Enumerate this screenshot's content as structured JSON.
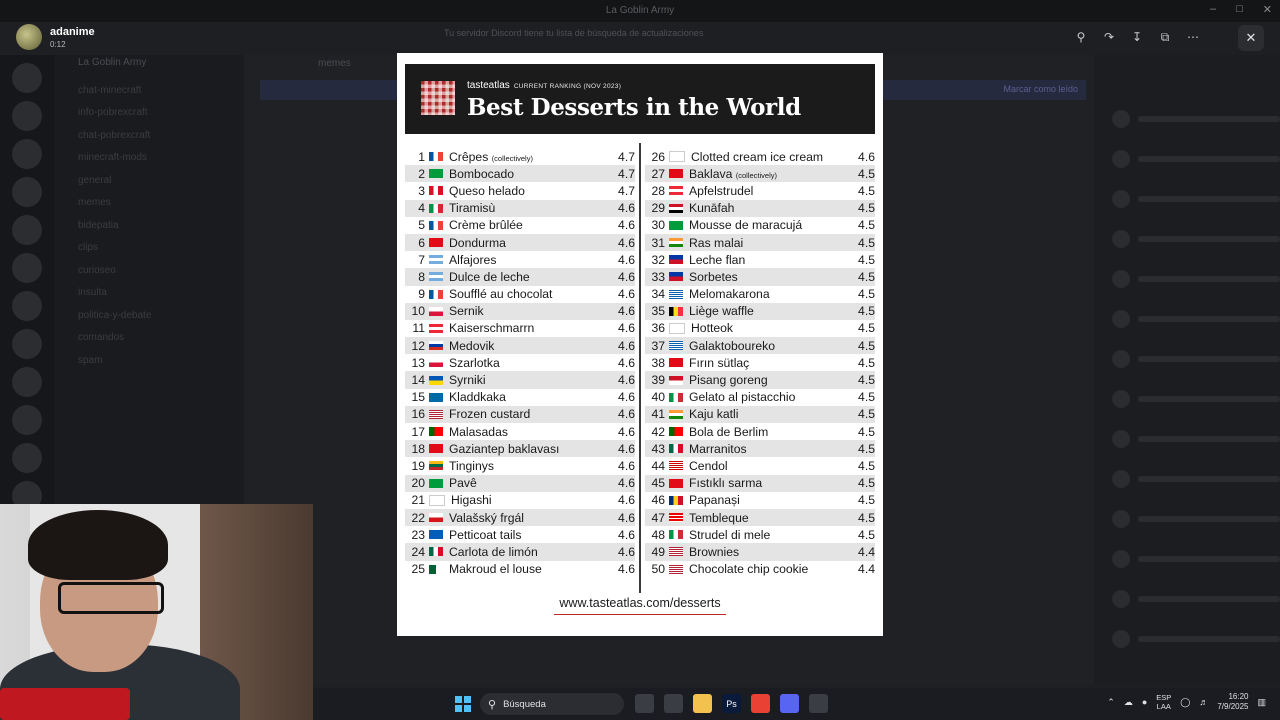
{
  "window": {
    "title": "La Goblin Army"
  },
  "server": {
    "name": "La Goblin Army",
    "channel": "memes"
  },
  "notice": {
    "text": "Tu servidor Discord tiene tu lista de búsqueda de actualizaciones"
  },
  "banner": {
    "button": "Marcar como leído"
  },
  "viewer": {
    "username": "adanime",
    "timestamp": "0:12"
  },
  "background_channels": [
    "chat-minecraft",
    "info-pobrexcraft",
    "chat-pobrexcraft",
    "minecraft-mods",
    "general",
    "memes",
    "bidepatia",
    "clips",
    "curioseo",
    "insulta",
    "politica-y-debate",
    "comandos",
    "spam"
  ],
  "image": {
    "brand": "tasteatlas",
    "ranking_label": "CURRENT RANKING (NOV 2023)",
    "title": "Best Desserts in the World",
    "url": "www.tasteatlas.com/desserts",
    "left": [
      {
        "rank": "1",
        "name": "Crêpes",
        "note": "(collectively)",
        "score": "4.7",
        "flag": "fr"
      },
      {
        "rank": "2",
        "name": "Bombocado",
        "note": "",
        "score": "4.7",
        "flag": "br"
      },
      {
        "rank": "3",
        "name": "Queso helado",
        "note": "",
        "score": "4.7",
        "flag": "pe"
      },
      {
        "rank": "4",
        "name": "Tiramisù",
        "note": "",
        "score": "4.6",
        "flag": "it"
      },
      {
        "rank": "5",
        "name": "Crème brûlée",
        "note": "",
        "score": "4.6",
        "flag": "fr"
      },
      {
        "rank": "6",
        "name": "Dondurma",
        "note": "",
        "score": "4.6",
        "flag": "tr"
      },
      {
        "rank": "7",
        "name": "Alfajores",
        "note": "",
        "score": "4.6",
        "flag": "ar"
      },
      {
        "rank": "8",
        "name": "Dulce de leche",
        "note": "",
        "score": "4.6",
        "flag": "ar"
      },
      {
        "rank": "9",
        "name": "Soufflé au chocolat",
        "note": "",
        "score": "4.6",
        "flag": "fr"
      },
      {
        "rank": "10",
        "name": "Sernik",
        "note": "",
        "score": "4.6",
        "flag": "pl"
      },
      {
        "rank": "11",
        "name": "Kaiserschmarrn",
        "note": "",
        "score": "4.6",
        "flag": "at"
      },
      {
        "rank": "12",
        "name": "Medovik",
        "note": "",
        "score": "4.6",
        "flag": "ru"
      },
      {
        "rank": "13",
        "name": "Szarlotka",
        "note": "",
        "score": "4.6",
        "flag": "pl"
      },
      {
        "rank": "14",
        "name": "Syrniki",
        "note": "",
        "score": "4.6",
        "flag": "ua"
      },
      {
        "rank": "15",
        "name": "Kladdkaka",
        "note": "",
        "score": "4.6",
        "flag": "se"
      },
      {
        "rank": "16",
        "name": "Frozen custard",
        "note": "",
        "score": "4.6",
        "flag": "us"
      },
      {
        "rank": "17",
        "name": "Malasadas",
        "note": "",
        "score": "4.6",
        "flag": "pt"
      },
      {
        "rank": "18",
        "name": "Gaziantep baklavası",
        "note": "",
        "score": "4.6",
        "flag": "tr"
      },
      {
        "rank": "19",
        "name": "Tinginys",
        "note": "",
        "score": "4.6",
        "flag": "lt"
      },
      {
        "rank": "20",
        "name": "Pavê",
        "note": "",
        "score": "4.6",
        "flag": "br"
      },
      {
        "rank": "21",
        "name": "Higashi",
        "note": "",
        "score": "4.6",
        "flag": "jp"
      },
      {
        "rank": "22",
        "name": "Valašský frgál",
        "note": "",
        "score": "4.6",
        "flag": "cz"
      },
      {
        "rank": "23",
        "name": "Petticoat tails",
        "note": "",
        "score": "4.6",
        "flag": "sc"
      },
      {
        "rank": "24",
        "name": "Carlota de limón",
        "note": "",
        "score": "4.6",
        "flag": "mx"
      },
      {
        "rank": "25",
        "name": "Makroud el louse",
        "note": "",
        "score": "4.6",
        "flag": "dz"
      }
    ],
    "right": [
      {
        "rank": "26",
        "name": "Clotted cream ice cream",
        "note": "",
        "score": "4.6",
        "flag": "en"
      },
      {
        "rank": "27",
        "name": "Baklava",
        "note": "(collectively)",
        "score": "4.5",
        "flag": "tr"
      },
      {
        "rank": "28",
        "name": "Apfelstrudel",
        "note": "",
        "score": "4.5",
        "flag": "at"
      },
      {
        "rank": "29",
        "name": "Kunāfah",
        "note": "",
        "score": "4.5",
        "flag": "eg"
      },
      {
        "rank": "30",
        "name": "Mousse de maracujá",
        "note": "",
        "score": "4.5",
        "flag": "br"
      },
      {
        "rank": "31",
        "name": "Ras malai",
        "note": "",
        "score": "4.5",
        "flag": "in"
      },
      {
        "rank": "32",
        "name": "Leche flan",
        "note": "",
        "score": "4.5",
        "flag": "ph"
      },
      {
        "rank": "33",
        "name": "Sorbetes",
        "note": "",
        "score": "4.5",
        "flag": "ph"
      },
      {
        "rank": "34",
        "name": "Melomakarona",
        "note": "",
        "score": "4.5",
        "flag": "gr"
      },
      {
        "rank": "35",
        "name": "Liège waffle",
        "note": "",
        "score": "4.5",
        "flag": "be"
      },
      {
        "rank": "36",
        "name": "Hotteok",
        "note": "",
        "score": "4.5",
        "flag": "kr"
      },
      {
        "rank": "37",
        "name": "Galaktoboureko",
        "note": "",
        "score": "4.5",
        "flag": "gr"
      },
      {
        "rank": "38",
        "name": "Fırın sütlaç",
        "note": "",
        "score": "4.5",
        "flag": "tr"
      },
      {
        "rank": "39",
        "name": "Pisang goreng",
        "note": "",
        "score": "4.5",
        "flag": "id"
      },
      {
        "rank": "40",
        "name": "Gelato al pistacchio",
        "note": "",
        "score": "4.5",
        "flag": "it"
      },
      {
        "rank": "41",
        "name": "Kaju katli",
        "note": "",
        "score": "4.5",
        "flag": "in"
      },
      {
        "rank": "42",
        "name": "Bola de Berlim",
        "note": "",
        "score": "4.5",
        "flag": "pt"
      },
      {
        "rank": "43",
        "name": "Marranitos",
        "note": "",
        "score": "4.5",
        "flag": "mx"
      },
      {
        "rank": "44",
        "name": "Cendol",
        "note": "",
        "score": "4.5",
        "flag": "my"
      },
      {
        "rank": "45",
        "name": "Fıstıklı sarma",
        "note": "",
        "score": "4.5",
        "flag": "tr"
      },
      {
        "rank": "46",
        "name": "Papanași",
        "note": "",
        "score": "4.5",
        "flag": "ro"
      },
      {
        "rank": "47",
        "name": "Tembleque",
        "note": "",
        "score": "4.5",
        "flag": "pr"
      },
      {
        "rank": "48",
        "name": "Strudel di mele",
        "note": "",
        "score": "4.5",
        "flag": "it"
      },
      {
        "rank": "49",
        "name": "Brownies",
        "note": "",
        "score": "4.4",
        "flag": "us"
      },
      {
        "rank": "50",
        "name": "Chocolate chip cookie",
        "note": "",
        "score": "4.4",
        "flag": "us"
      }
    ]
  },
  "taskbar": {
    "search_placeholder": "Búsqueda",
    "lang_line1": "ESP",
    "lang_line2": "LAA",
    "time": "16:20",
    "date": "7/9/2025",
    "apps": [
      {
        "name": "task-view",
        "color": "#3a3d44",
        "glyph": ""
      },
      {
        "name": "app",
        "color": "#3a3d44",
        "glyph": ""
      },
      {
        "name": "file-explorer",
        "color": "#f2c14e",
        "glyph": ""
      },
      {
        "name": "photoshop",
        "color": "#0a1a3a",
        "glyph": "Ps"
      },
      {
        "name": "chrome",
        "color": "#e94235",
        "glyph": ""
      },
      {
        "name": "discord",
        "color": "#5865f2",
        "glyph": ""
      },
      {
        "name": "app",
        "color": "#3a3d44",
        "glyph": ""
      }
    ]
  },
  "colors": {
    "accent_red": "#c02525",
    "image_header": "#1b1b1b",
    "row_stripe": "#e4e4e4"
  }
}
